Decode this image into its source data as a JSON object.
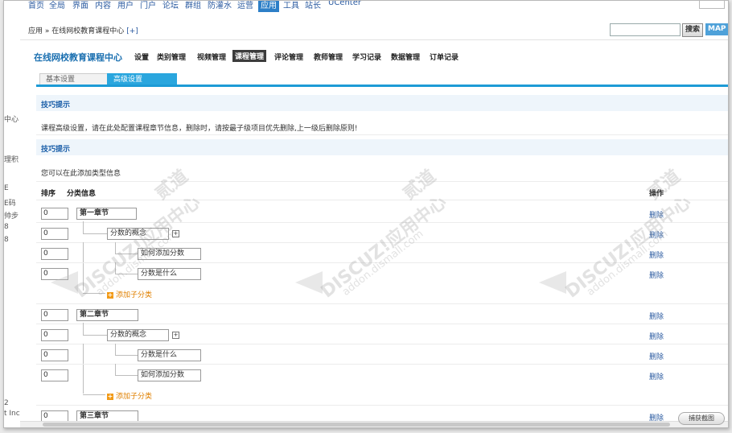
{
  "topnav": {
    "items": [
      "首页",
      "全局",
      "界面",
      "内容",
      "用户",
      "门户",
      "论坛",
      "群组",
      "防灌水",
      "运营",
      "应用",
      "工具",
      "站长",
      "UCenter"
    ],
    "active_index": 10
  },
  "breadcrumb": {
    "text": "应用 » 在线网校教育课程中心",
    "plus": "[+]"
  },
  "search": {
    "placeholder": "",
    "button": "搜索",
    "map_button": "MAP"
  },
  "module": {
    "title": "在线网校教育课程中心",
    "tabs": [
      "设置",
      "类别管理",
      "视频管理",
      "课程管理",
      "评论管理",
      "教师管理",
      "学习记录",
      "数据管理",
      "订单记录"
    ],
    "active_tab": "课程管理"
  },
  "subtabs": {
    "basic": "基本设置",
    "advanced": "高级设置"
  },
  "tips1": {
    "head": "技巧提示",
    "text": "课程高级设置，请在此处配置课程章节信息，删除时，请按最子级项目优先删除,上一级后删除原则!"
  },
  "tips2": {
    "head": "技巧提示",
    "text": "您可以在此添加类型信息"
  },
  "table": {
    "col_order": "排序",
    "col_info": "分类信息",
    "col_action": "操作",
    "delete_label": "删除",
    "add_child_label": "添加子分类",
    "rows": [
      {
        "order": "0",
        "name": "第一章节",
        "level": 0
      },
      {
        "order": "0",
        "name": "分数的概念",
        "level": 1
      },
      {
        "order": "0",
        "name": "如何添加分数",
        "level": 2
      },
      {
        "order": "0",
        "name": "分数是什么",
        "level": 2
      },
      {
        "order": "0",
        "name": "第二章节",
        "level": 0
      },
      {
        "order": "0",
        "name": "分数的概念",
        "level": 1
      },
      {
        "order": "0",
        "name": "分数是什么",
        "level": 2
      },
      {
        "order": "0",
        "name": "如何添加分数",
        "level": 2
      },
      {
        "order": "0",
        "name": "第三章节",
        "level": 0
      }
    ]
  },
  "sidebar_fragments": [
    "中心",
    "理积",
    "E",
    "E码",
    "帅步",
    "8",
    "8",
    "2",
    "t Inc"
  ],
  "watermark": {
    "text": "DISCUZ!应用中心",
    "sub": "addon.dismall.com",
    "mark": "贰道"
  },
  "capture_button": "捕获截图"
}
